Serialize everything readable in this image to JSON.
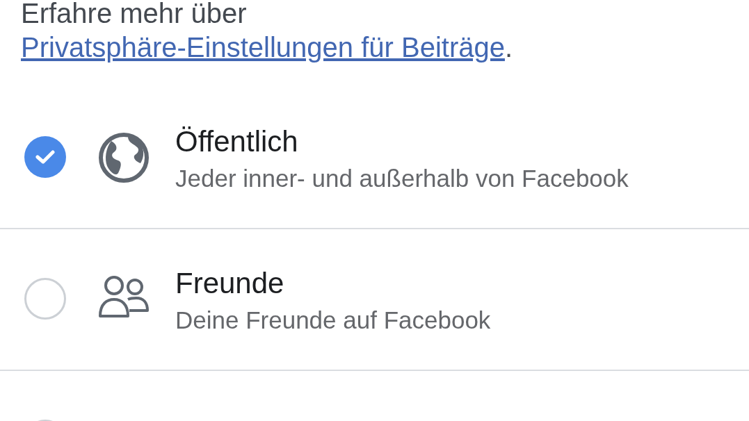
{
  "intro": {
    "text": "Erfahre mehr über ",
    "link": "Privatsphäre-Einstellungen für Beiträge",
    "suffix": "."
  },
  "options": [
    {
      "kind": "globe",
      "title": "Öffentlich",
      "subtitle": "Jeder inner- und außerhalb von Facebook",
      "selected": true
    },
    {
      "kind": "friends",
      "title": "Freunde",
      "subtitle": "Deine Freunde auf Facebook",
      "selected": false
    },
    {
      "selected": false
    }
  ]
}
